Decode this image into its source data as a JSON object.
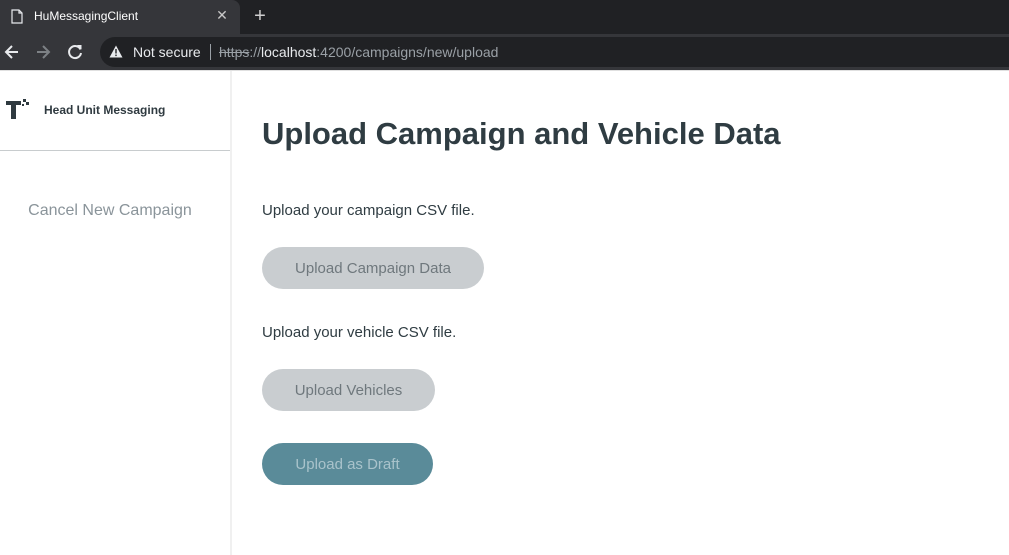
{
  "browser": {
    "tab_title": "HuMessagingClient",
    "tab_close_glyph": "✕",
    "new_tab_glyph": "+",
    "security_label": "Not secure",
    "url": {
      "scheme": "https",
      "separator": "://",
      "host": "localhost",
      "rest": ":4200/campaigns/new/upload"
    }
  },
  "sidebar": {
    "app_name": "Head Unit Messaging",
    "cancel_label": "Cancel New Campaign"
  },
  "main": {
    "title": "Upload Campaign and Vehicle Data",
    "campaign_prompt": "Upload your campaign CSV file.",
    "campaign_button": "Upload Campaign Data",
    "vehicle_prompt": "Upload your vehicle CSV file.",
    "vehicle_button": "Upload Vehicles",
    "draft_button": "Upload as Draft"
  },
  "colors": {
    "primary_teal": "#5a8b99",
    "disabled_gray": "#c9cdd0",
    "heading_text": "#2f3c42"
  }
}
